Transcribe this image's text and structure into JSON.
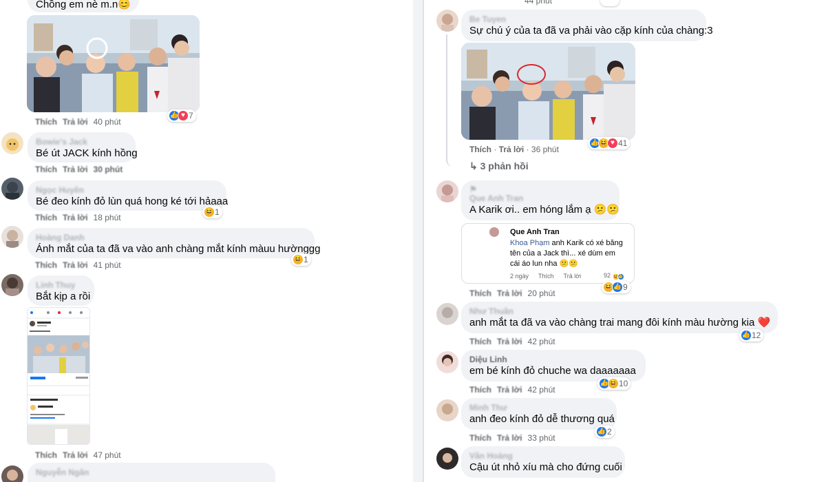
{
  "left": {
    "c0": {
      "text": "Chồng em nè m.n😊"
    },
    "c1": {
      "actions": {
        "like": "Thích",
        "reply": "Trả lời",
        "time": "40 phút"
      },
      "reaction_count": "7"
    },
    "c2": {
      "author": "Bowie's Jack",
      "text": "Bé út JACK kính hồng",
      "actions": {
        "like": "Thích",
        "reply": "Trả lời",
        "time": "30 phút"
      }
    },
    "c3": {
      "author": "Ngọc Huyền",
      "text": "Bé đeo kính đỏ lùn quá hong ké tới hảaaa",
      "actions": {
        "like": "Thích",
        "reply": "Trả lời",
        "time": "18 phút"
      },
      "reaction_count": "1"
    },
    "c4": {
      "author": "Hoàng Danh",
      "text": "Ánh mắt của ta đã va vào anh chàng mắt kính màuu hườnggg",
      "actions": {
        "like": "Thích",
        "reply": "Trả lời",
        "time": "41 phút"
      },
      "reaction_count": "1"
    },
    "c5": {
      "author": "Linh Thuy",
      "text": "Bắt kịp a rồi",
      "actions": {
        "like": "Thích",
        "reply": "Trả lời",
        "time": "47 phút"
      }
    },
    "c6": {
      "author": "Nguyễn Ngân"
    }
  },
  "right": {
    "r0": {
      "time": "44 phút"
    },
    "r1": {
      "author": "Be Tuyen",
      "text": "Sự chú ý của ta đã va phải vào cặp kính của chàng:3",
      "actions": {
        "like": "Thích",
        "reply": "Trả lời",
        "time": "36 phút"
      },
      "reaction_count": "41",
      "replies": "↳ 3 phản hồi"
    },
    "r2": {
      "author": "Que Anh Tran",
      "text": "A Karik ơi.. em hóng lắm ạ 😕😕",
      "quote": {
        "author": "Que Anh Tran",
        "mention": "Khoa Phạm",
        "text": " anh Karik có xé băng tên của a Jack thì...  xé dùm em cái áo lun nha 😕😕",
        "time": "2 ngày",
        "like": "Thích",
        "reply": "Trả lời",
        "count": "92"
      },
      "actions": {
        "like": "Thích",
        "reply": "Trả lời",
        "time": "20 phút"
      },
      "reaction_count": "9"
    },
    "r3": {
      "author": "Như Thuần",
      "text": "anh mắt ta đã va vào chàng trai mang đôi kính màu hường kia ❤️",
      "actions": {
        "like": "Thích",
        "reply": "Trả lời",
        "time": "42 phút"
      },
      "reaction_count": "12"
    },
    "r4": {
      "author": "Diệu Linh",
      "text": "em bé kính đỏ chuche wa daaaaaaa",
      "actions": {
        "like": "Thích",
        "reply": "Trả lời",
        "time": "42 phút"
      },
      "reaction_count": "10"
    },
    "r5": {
      "author": "Minh Thư",
      "text": "anh đeo kính đỏ dễ thương quá",
      "actions": {
        "like": "Thích",
        "reply": "Trả lời",
        "time": "33 phút"
      },
      "reaction_count": "2"
    },
    "r6": {
      "author": "Vân Hoàng",
      "text": "Cậu út nhỏ xíu mà cho đứng cuối"
    }
  },
  "colors": {
    "bubble": "#f0f2f5",
    "like": "#1877f2",
    "haha": "#f7b125",
    "love": "#f33e58",
    "meta": "#65676b"
  },
  "icons": [
    "like-reaction-icon",
    "haha-reaction-icon",
    "love-reaction-icon",
    "reply-arrow-icon"
  ]
}
